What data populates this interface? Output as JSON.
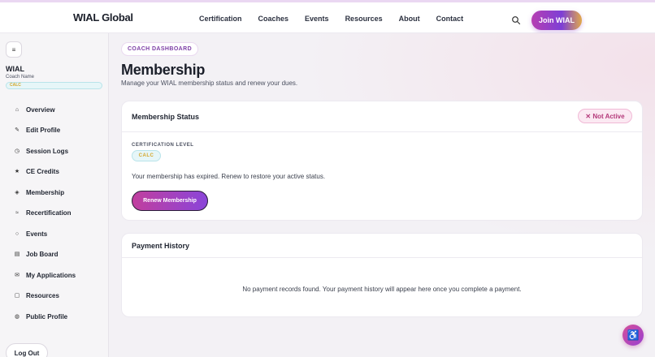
{
  "header": {
    "logo": "WIAL Global",
    "nav": [
      "Certification",
      "Coaches",
      "Events",
      "Resources",
      "About",
      "Contact"
    ],
    "search_icon": "search-icon",
    "join_label": "Join WIAL"
  },
  "sidebar": {
    "toggle_icon": "menu-icon",
    "toggle_glyph": "≡",
    "name": "WIAL",
    "subtitle": "Coach Name",
    "badge": "CALC",
    "items": [
      {
        "label": "Overview",
        "icon": "home-icon",
        "glyph": "⌂"
      },
      {
        "label": "Edit Profile",
        "icon": "edit-icon",
        "glyph": "✎"
      },
      {
        "label": "Session Logs",
        "icon": "clock-icon",
        "glyph": "◷"
      },
      {
        "label": "CE Credits",
        "icon": "star-icon",
        "glyph": "★"
      },
      {
        "label": "Membership",
        "icon": "diamond-icon",
        "glyph": "◈"
      },
      {
        "label": "Recertification",
        "icon": "refresh-icon",
        "glyph": "≈"
      },
      {
        "label": "Events",
        "icon": "calendar-icon",
        "glyph": "○"
      },
      {
        "label": "Job Board",
        "icon": "briefcase-icon",
        "glyph": "▤"
      },
      {
        "label": "My Applications",
        "icon": "mail-icon",
        "glyph": "✉"
      },
      {
        "label": "Resources",
        "icon": "book-icon",
        "glyph": "▢"
      },
      {
        "label": "Public Profile",
        "icon": "globe-icon",
        "glyph": "◍"
      }
    ],
    "logout_label": "Log Out"
  },
  "main": {
    "chip": "COACH DASHBOARD",
    "title": "Membership",
    "subtitle": "Manage your WIAL membership status and renew your dues.",
    "status_card": {
      "title": "Membership Status",
      "status_label": "✕ Not Active",
      "cert_label": "CERTIFICATION LEVEL",
      "cert_value": "CALC",
      "message": "Your membership has expired. Renew to restore your active status.",
      "renew_label": "Renew Membership"
    },
    "payment_card": {
      "title": "Payment History",
      "empty_message": "No payment records found. Your payment history will appear here once you complete a payment."
    }
  },
  "accessibility": {
    "icon": "accessibility-icon",
    "glyph": "♿"
  },
  "colors": {
    "accent": "#8a45d9",
    "brand_pink": "#c13f9e",
    "status_inactive": "#b43a7a",
    "badge_gold": "#d4a62a"
  }
}
